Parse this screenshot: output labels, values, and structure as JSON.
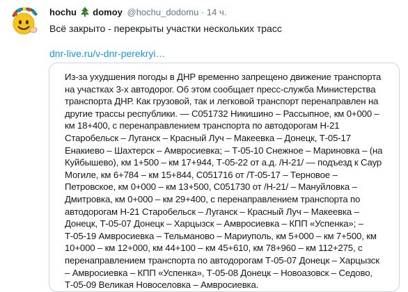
{
  "tweet": {
    "display_name": "hochu",
    "display_name_suffix": "domoy",
    "handle": "@hochu_dodomu",
    "separator": "·",
    "time": "14 ч.",
    "text": "Всё закрыто - перекрыты участки нескольких трасс",
    "link": "dnr-live.ru/v-dnr-perekryi…",
    "emoji_icon": "christmas-tree-icon",
    "avatar_icon": "smiley-with-wreath-avatar"
  },
  "card": {
    "body": "Из-за ухудшения погоды в ДНР временно запрещено движение транспорта на участках 3-х автодорог. Об этом сообщает пресс-служба Министерства транспорта ДНР. Как грузовой, так и легковой транспорт перенаправлен на другие трассы республики. — С051732 Никишино – Рассыпное, км 0+000 – км 18+400, с перенаправлением транспорта по автодорогам Н-21 Старобельск – Луганск – Красный Луч – Макеевка – Донецк, Т-05-17 Енакиево – Шахтерск – Амвросиевка; – Т-05-10 Снежное – Мариновка – (на Куйбышево), км 1+500 – км 17+944, Т-05-22 от а.д. /Н-21/ — подъезд к Саур Могиле, км 6+784 – км 15+844, С051716 от /Т-05-17 – Терновое – Петровское, км 0+000 – км 13+500, С051730 от /Н-21/ – Мануйловка – Дмитровка, км 0+000 – км 29+400, с перенаправлением транспорта по автодорогам Н-21 Старобельск – Луганск – Красный Луч – Макеевка – Донецк, Т-05-07 Донецк – Харцызск – Амвросиевка – КПП «Успенка»; – Т-05-19 Амвросиевка – Тельманово – Мариуполь, км 5+000 – км 7+500, км 10+000 – км 12+000, км 44+100 – км 45+610, км 78+960 – км 112+275, с перенаправлением транспорта по автодорогам Т-05-07 Донецк – Харцызск – Амвросиевка – КПП «Успенка», Т-05-08 Донецк – Новоазовск – Седово, Т-05-09 Великая Новоселовка – Амвросиевка."
  }
}
